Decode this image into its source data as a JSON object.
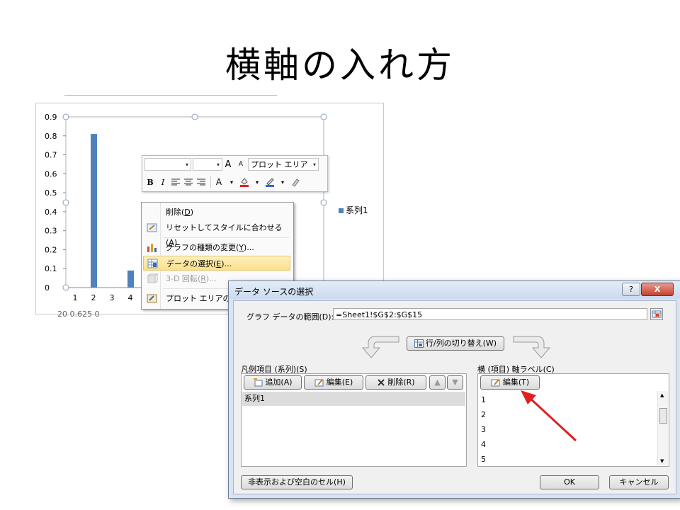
{
  "slide": {
    "title": "横軸の入れ方"
  },
  "chart": {
    "legend_label": "系列1",
    "bottom_text": "20       0.625 0",
    "series_color": "#4f81bd"
  },
  "chart_data": {
    "type": "bar",
    "categories": [
      "1",
      "2",
      "3",
      "4"
    ],
    "series": [
      {
        "name": "系列1",
        "values": [
          0,
          0.81,
          0,
          0.09
        ]
      }
    ],
    "ylim": [
      0,
      0.9
    ],
    "yticks": [
      "0",
      "0.1",
      "0.2",
      "0.3",
      "0.4",
      "0.5",
      "0.6",
      "0.7",
      "0.8",
      "0.9"
    ],
    "legend_position": "right"
  },
  "mini_toolbar": {
    "font_name": "",
    "font_size": "",
    "target": "プロット エリア",
    "grow_font": "A",
    "shrink_font": "A",
    "bold": "B",
    "italic": "I",
    "font_color": "A"
  },
  "context_menu": {
    "items": [
      {
        "label": "削除(",
        "key": "D",
        "tail": ")",
        "state": "normal"
      },
      {
        "label": "リセットしてスタイルに合わせる(",
        "key": "A",
        "tail": ")",
        "state": "normal"
      },
      {
        "label": "グラフの種類の変更(",
        "key": "Y",
        "tail": ")...",
        "state": "normal"
      },
      {
        "label": "データの選択(",
        "key": "E",
        "tail": ")...",
        "state": "selected"
      },
      {
        "label": "3-D 回転(",
        "key": "R",
        "tail": ")...",
        "state": "disabled"
      },
      {
        "label": "プロット エリアの書式",
        "key": "",
        "tail": "",
        "state": "normal"
      }
    ]
  },
  "dialog": {
    "title": "データ ソースの選択",
    "help": "?",
    "close": "X",
    "range_label": "グラフ データの範囲(D):",
    "range_value": "=Sheet1!$G$2:$G$15",
    "switch_label": "行/列の切り替え(W)",
    "legend_section_label": "凡例項目 (系列)(S)",
    "axis_section_label": "横 (項目) 軸ラベル(C)",
    "add_label": "追加(A)",
    "edit_label": "編集(E)",
    "delete_label": "削除(R)",
    "axis_edit_label": "編集(T)",
    "series_items": [
      "系列1"
    ],
    "axis_items": [
      "1",
      "2",
      "3",
      "4",
      "5"
    ],
    "hidden_cells_label": "非表示および空白のセル(H)",
    "ok_label": "OK",
    "cancel_label": "キャンセル"
  },
  "annotation": {
    "arrow_color": "#e02020"
  }
}
